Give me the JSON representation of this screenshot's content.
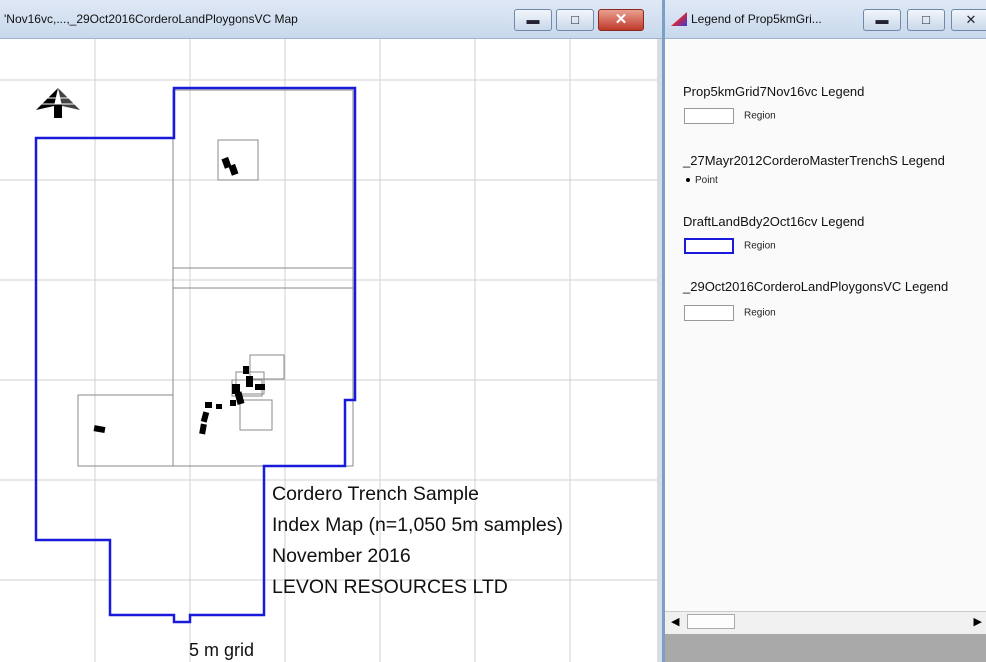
{
  "map_window": {
    "title": "'Nov16vc,...,_29Oct2016CorderoLandPloygonsVC Map",
    "minimize_icon": "minimize-icon",
    "maximize_icon": "maximize-icon",
    "close_icon": "close-icon",
    "north_arrow_icon": "north-arrow-icon",
    "label_lines": [
      "Cordero Trench Sample",
      "Index Map  (n=1,050 5m samples)",
      "November 2016",
      "LEVON RESOURCES LTD"
    ],
    "scale_label": "5 m grid",
    "colors": {
      "boundary": "#1a1adc",
      "grid": "#cfcfcf",
      "samples": "#000000"
    }
  },
  "legend_window": {
    "title": "Legend of Prop5kmGri...",
    "sections": [
      {
        "title": "Prop5kmGrid7Nov16vc Legend",
        "item_label": "Region",
        "swatch": "grey-region"
      },
      {
        "title": "_27Mayr2012CorderoMasterTrenchS Legend",
        "item_label": "Point",
        "swatch": "point"
      },
      {
        "title": "DraftLandBdy2Oct16cv Legend",
        "item_label": "Region",
        "swatch": "blue-region"
      },
      {
        "title": "_29Oct2016CorderoLandPloygonsVC Legend",
        "item_label": "Region",
        "swatch": "grey-region"
      }
    ],
    "scroll_left_icon": "scroll-left-icon",
    "scroll_right_icon": "scroll-right-icon"
  }
}
